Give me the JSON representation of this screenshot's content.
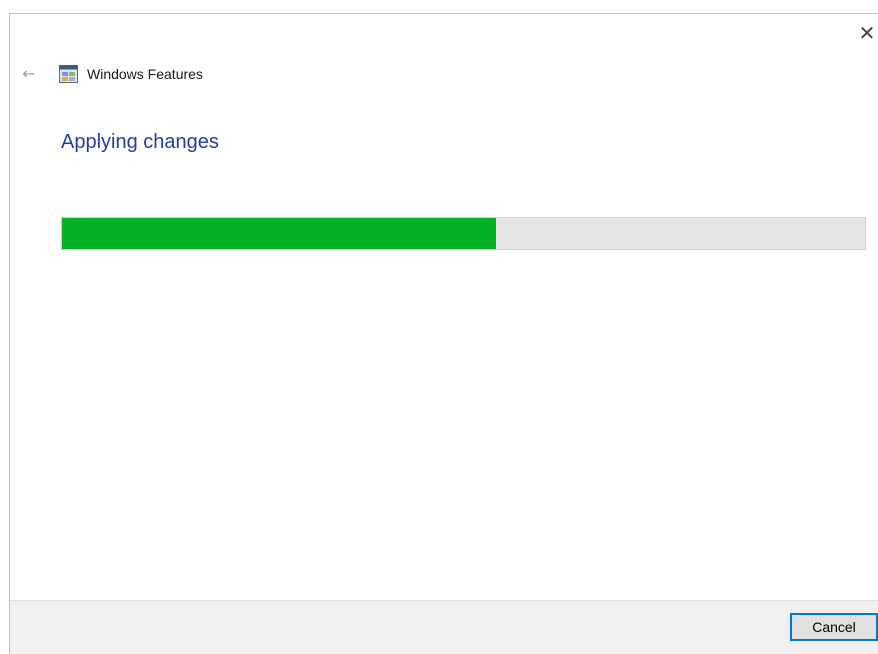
{
  "window": {
    "close_glyph": "✕",
    "back_glyph": "←"
  },
  "header": {
    "app_title": "Windows Features",
    "icon": "windows-features-icon"
  },
  "main": {
    "heading": "Applying changes",
    "progress_percent": 54,
    "progress_color": "#06b025",
    "track_color": "#e6e6e6",
    "heading_color": "#1f3fa0"
  },
  "footer": {
    "cancel_label": "Cancel"
  }
}
